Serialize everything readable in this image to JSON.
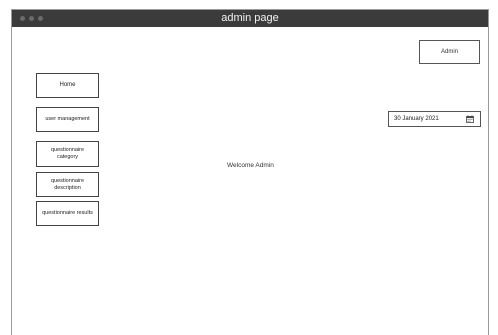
{
  "window": {
    "title": "admin page"
  },
  "header": {
    "admin_label": "Admin"
  },
  "nav": [
    {
      "label": "Home"
    },
    {
      "label": "user management"
    },
    {
      "label": "questionnaire category"
    },
    {
      "label": "questionnaire description"
    },
    {
      "label": "questionnaire results"
    }
  ],
  "date_picker": {
    "value": "30 January 2021",
    "icon": "calendar-icon"
  },
  "main": {
    "welcome_text": "Welcome Admin"
  }
}
